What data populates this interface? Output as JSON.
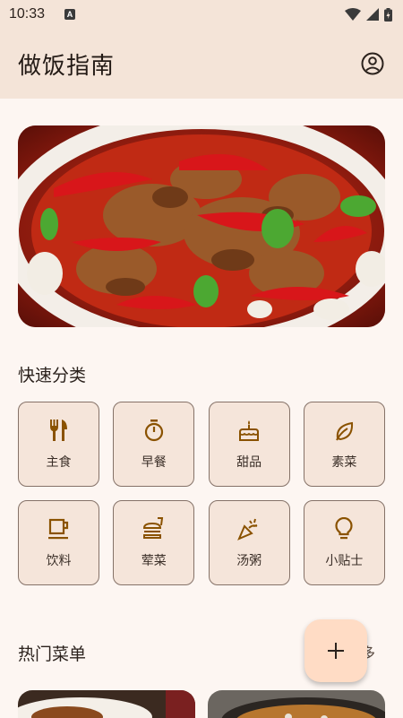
{
  "status_bar": {
    "time": "10:33",
    "notification_icon": "a-badge-icon"
  },
  "app_bar": {
    "title": "做饭指南",
    "account_icon": "account-circle-icon"
  },
  "hero": {
    "image": "spicy-chicken-dish"
  },
  "categories_section": {
    "title": "快速分类",
    "items": [
      {
        "label": "主食",
        "icon": "fork-knife-icon"
      },
      {
        "label": "早餐",
        "icon": "timer-icon"
      },
      {
        "label": "甜品",
        "icon": "cake-icon"
      },
      {
        "label": "素菜",
        "icon": "leaf-icon"
      },
      {
        "label": "饮料",
        "icon": "cup-icon"
      },
      {
        "label": "荤菜",
        "icon": "burger-icon"
      },
      {
        "label": "汤粥",
        "icon": "celebration-icon"
      },
      {
        "label": "小贴士",
        "icon": "lightbulb-icon"
      }
    ]
  },
  "hot_section": {
    "title": "热门菜单",
    "more": "多"
  },
  "fab": {
    "icon": "add-icon"
  },
  "colors": {
    "app_bar": "#f4e4d8",
    "background": "#fdf6f2",
    "card": "#f5e5da",
    "icon": "#8a5200",
    "fab": "#ffdcc5"
  }
}
